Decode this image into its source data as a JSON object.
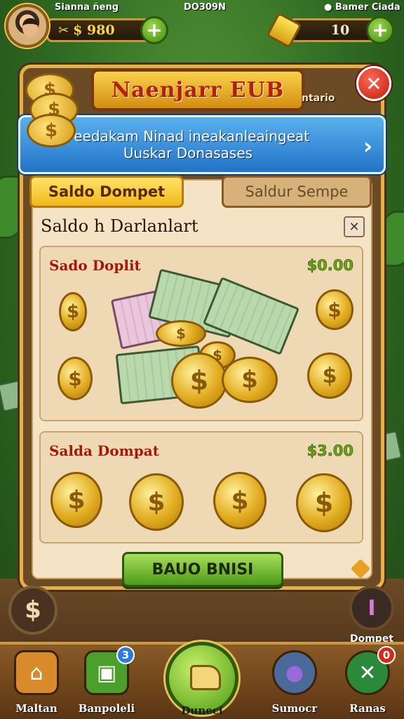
{
  "status_bar": {
    "left": "Sianna ñeng",
    "center": "DO309N",
    "right": "● Bamer Ciada"
  },
  "hud": {
    "coin_icon": "✂",
    "coin_value": "$ 980",
    "gem_value": "10",
    "plus_symbol": "+"
  },
  "panel": {
    "title": "Naenjarr EUB",
    "title_side_text": "ntario",
    "close_symbol": "✕",
    "banner_line1": "Feedakam Ninad ineakanleaingeat",
    "banner_line2": "Uuskar Donasases",
    "banner_chevron": "›",
    "tabs": [
      {
        "label": "Saldo Dompet",
        "active": true
      },
      {
        "label": "Saldur Sempe",
        "active": false
      }
    ],
    "section_title": "Saldo h Darlanlart",
    "section_close": "✕",
    "cards": [
      {
        "label": "Sado Doplit",
        "amount": "$0.00"
      },
      {
        "label": "Salda Dompat",
        "amount": "$3.00"
      }
    ],
    "coin_glyph": "$",
    "cta_label": "BAUO BNISI"
  },
  "side_buttons": {
    "left_symbol": "$",
    "right_symbol": "I",
    "right_label": "Dompet"
  },
  "nav": {
    "items": [
      {
        "label": "Maltan",
        "icon": "house-icon",
        "symbol": "⌂",
        "color": "#d98a2a"
      },
      {
        "label": "Banpoleli",
        "icon": "ticket-icon",
        "symbol": "▣",
        "color": "#4aa02a",
        "badge": "3",
        "badge_color": "#2a7ae0"
      },
      {
        "label": "Duneci",
        "icon": "wallet-icon"
      },
      {
        "label": "Sumocr",
        "icon": "bag-icon",
        "symbol": "●",
        "color": "#4a6a9a"
      },
      {
        "label": "Ranas",
        "icon": "cross-tools-icon",
        "symbol": "✕",
        "color": "#2a8a3a",
        "badge": "0",
        "badge_color": "#d42a1a"
      }
    ]
  }
}
